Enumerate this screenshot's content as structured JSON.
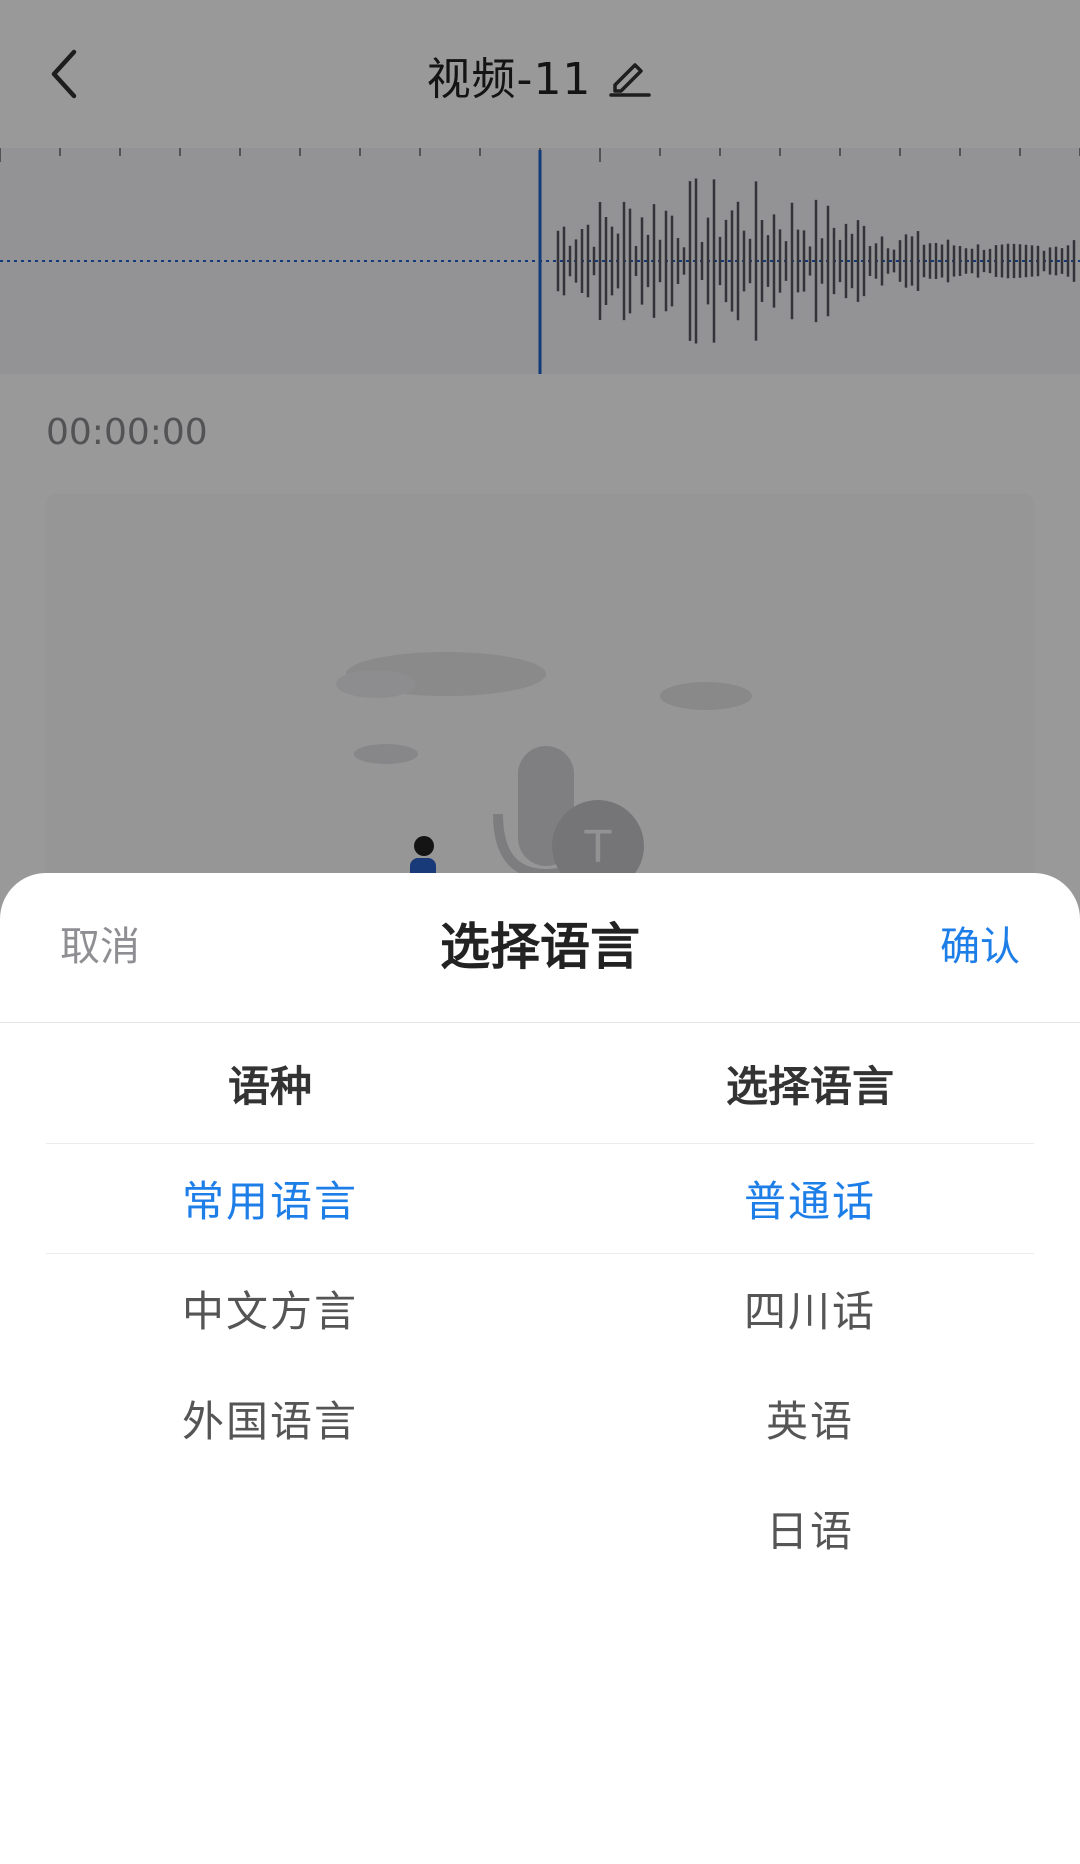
{
  "header": {
    "back_icon": "chevron-left-icon",
    "title": "视频-11",
    "edit_icon": "pencil-icon"
  },
  "recording": {
    "time": "00:00:00"
  },
  "sheet": {
    "cancel_label": "取消",
    "title": "选择语言",
    "confirm_label": "确认",
    "left_column": {
      "header": "语种",
      "options": [
        "常用语言",
        "中文方言",
        "外国语言"
      ],
      "selected_index": 0
    },
    "right_column": {
      "header": "选择语言",
      "options": [
        "普通话",
        "四川话",
        "英语",
        "日语"
      ],
      "selected_index": 0
    }
  },
  "colors": {
    "accent": "#1e7ee8",
    "overlay": "rgba(0,0,0,0.40)",
    "waveform": "#555560",
    "playhead": "#1e5fc8"
  }
}
